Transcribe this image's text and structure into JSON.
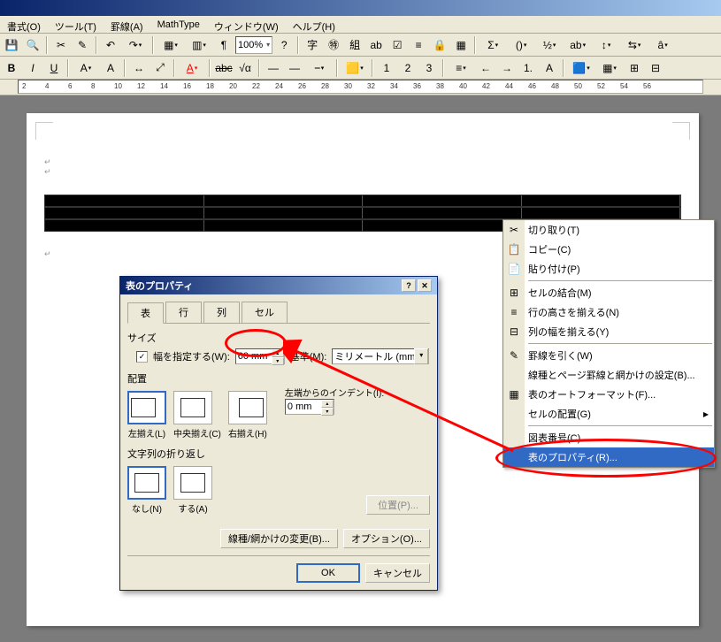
{
  "menus": [
    "書式(O)",
    "ツール(T)",
    "罫線(A)",
    "MathType",
    "ウィンドウ(W)",
    "ヘルプ(H)"
  ],
  "zoom": "100%",
  "ruler_marks": [
    2,
    4,
    6,
    8,
    10,
    12,
    14,
    16,
    18,
    20,
    22,
    24,
    26,
    28,
    30,
    32,
    34,
    36,
    38,
    40,
    42,
    44,
    46,
    48,
    50,
    52,
    54,
    56
  ],
  "contextmenu": {
    "items": [
      {
        "icon": "✂",
        "label": "切り取り(T)"
      },
      {
        "icon": "📋",
        "label": "コピー(C)"
      },
      {
        "icon": "📄",
        "label": "貼り付け(P)"
      },
      {
        "sep": true
      },
      {
        "icon": "⊞",
        "label": "セルの結合(M)"
      },
      {
        "icon": "≡",
        "label": "行の高さを揃える(N)"
      },
      {
        "icon": "⊟",
        "label": "列の幅を揃える(Y)"
      },
      {
        "sep": true
      },
      {
        "icon": "✎",
        "label": "罫線を引く(W)"
      },
      {
        "label": "線種とページ罫線と網かけの設定(B)..."
      },
      {
        "icon": "▦",
        "label": "表のオートフォーマット(F)..."
      },
      {
        "label": "セルの配置(G)",
        "arrow": true
      },
      {
        "sep": true
      },
      {
        "label": "図表番号(C)..."
      },
      {
        "label": "表のプロパティ(R)...",
        "highlighted": true
      }
    ]
  },
  "dialog": {
    "title": "表のプロパティ",
    "tabs": [
      "表",
      "行",
      "列",
      "セル"
    ],
    "active_tab": 0,
    "size_group": "サイズ",
    "width_check": "幅を指定する(W):",
    "width_value": "60 mm",
    "basis_label": "基準(M):",
    "basis_value": "ミリメートル (mm)",
    "alignment_group": "配置",
    "align_options": [
      "左揃え(L)",
      "中央揃え(C)",
      "右揃え(H)"
    ],
    "align_selected": 0,
    "indent_label": "左端からのインデント(I):",
    "indent_value": "0 mm",
    "wrap_group": "文字列の折り返し",
    "wrap_options": [
      "なし(N)",
      "する(A)"
    ],
    "wrap_selected": 0,
    "position_btn": "位置(P)...",
    "border_btn": "線種/網かけの変更(B)...",
    "options_btn": "オプション(O)...",
    "ok": "OK",
    "cancel": "キャンセル"
  }
}
